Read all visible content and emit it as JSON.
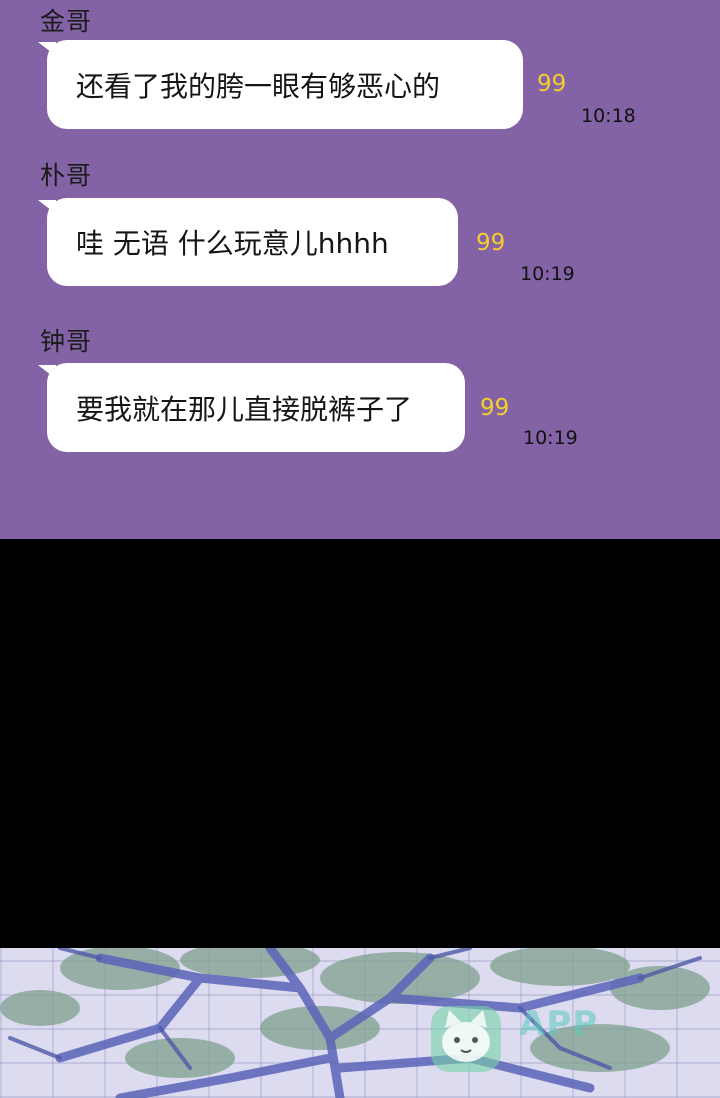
{
  "messages": [
    {
      "sender": "金哥",
      "text": "还看了我的胯一眼有够恶心的",
      "unread": "99",
      "time": "10:18"
    },
    {
      "sender": "朴哥",
      "text": "哇 无语 什么玩意儿hhhh",
      "unread": "99",
      "time": "10:19"
    },
    {
      "sender": "钟哥",
      "text": "要我就在那儿直接脱裤子了",
      "unread": "99",
      "time": "10:19"
    }
  ],
  "watermark": {
    "icon": "cat-face-icon",
    "text": "APP"
  },
  "colors": {
    "chat_background": "#8363a5",
    "bubble": "#ffffff",
    "unread_count": "#f5cd2d",
    "band": "#000000",
    "illustration_sky": "#dcdbf0",
    "branches": "#5a64b8",
    "leaves": "#7fa08e"
  }
}
